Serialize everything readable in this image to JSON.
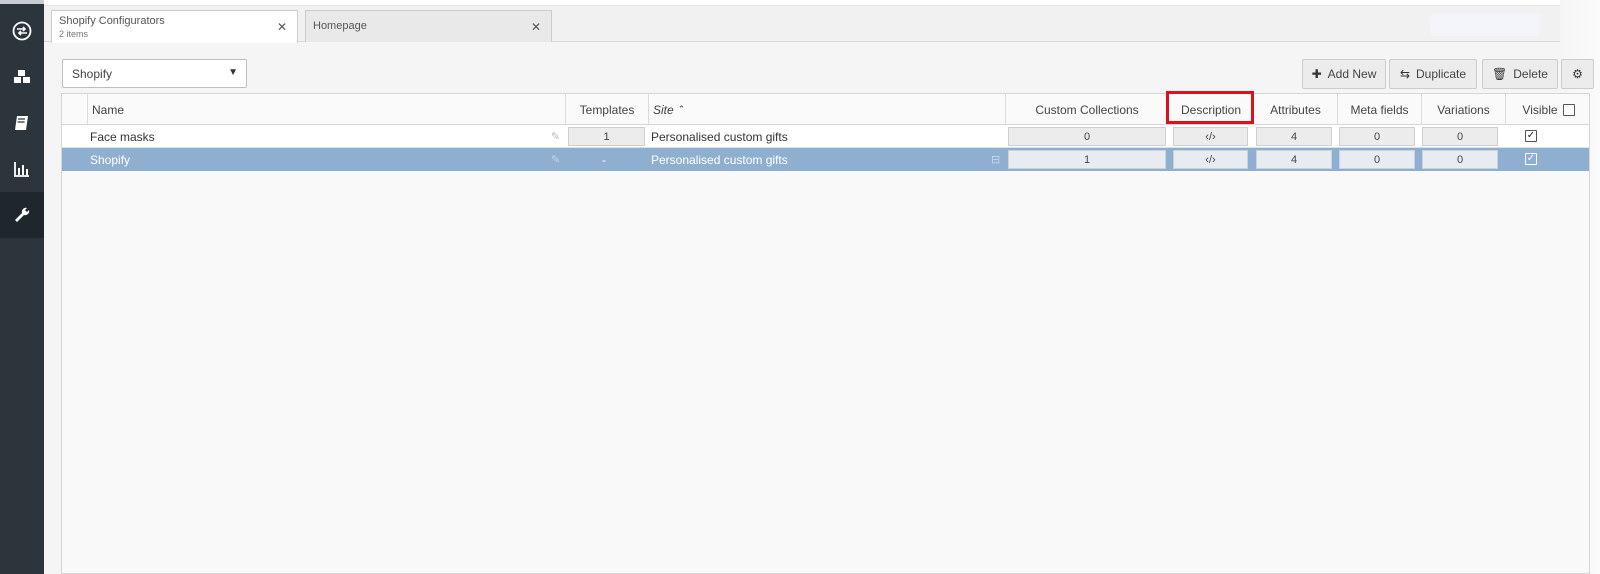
{
  "tabs": [
    {
      "title": "Shopify Configurators",
      "subtitle": "2 items",
      "close": "✕"
    },
    {
      "title": "Homepage",
      "close": "✕"
    }
  ],
  "toolbar": {
    "store_select": "Shopify",
    "add_new": "Add New",
    "duplicate": "Duplicate",
    "delete": "Delete"
  },
  "columns": {
    "name": "Name",
    "templates": "Templates",
    "site": "Site",
    "custom_collections": "Custom Collections",
    "description": "Description",
    "attributes": "Attributes",
    "meta_fields": "Meta fields",
    "variations": "Variations",
    "visible": "Visible"
  },
  "rows": [
    {
      "name": "Face masks",
      "templates": "1",
      "site": "Personalised custom gifts",
      "custom_collections": "0",
      "description": "‹/›",
      "attributes": "4",
      "meta_fields": "0",
      "variations": "0",
      "visible": true
    },
    {
      "name": "Shopify",
      "templates": "-",
      "site": "Personalised custom gifts",
      "custom_collections": "1",
      "description": "‹/›",
      "attributes": "4",
      "meta_fields": "0",
      "variations": "0",
      "visible": true
    }
  ],
  "icons": {
    "sidebar": [
      "exchange-icon",
      "cubes-icon",
      "book-icon",
      "bar-chart-icon",
      "wrench-icon"
    ]
  },
  "colors": {
    "sidebar": "#2d353c",
    "selected_row": "#8fafd0",
    "highlight": "#e0101a"
  }
}
